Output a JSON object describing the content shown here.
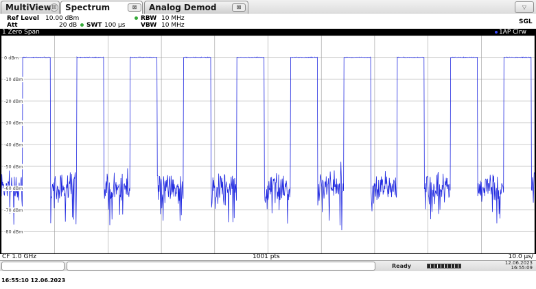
{
  "tabs": [
    {
      "label": "MultiView",
      "icon": "grid-icon"
    },
    {
      "label": "Spectrum",
      "icon": "close-icon",
      "active": true
    },
    {
      "label": "Analog Demod",
      "icon": "close-icon"
    }
  ],
  "dropdown_icon": "chevron-down-icon",
  "params": {
    "ref_level_label": "Ref Level",
    "ref_level_value": "10.00 dBm",
    "att_label": "Att",
    "att_value": "20 dB",
    "swt_label": "SWT",
    "swt_value": "100 µs",
    "rbw_label": "RBW",
    "rbw_value": "10 MHz",
    "vbw_label": "VBW",
    "vbw_value": "10 MHz",
    "mode": "SGL"
  },
  "window": {
    "title": "1 Zero Span",
    "trace_label": "1AP Clrw",
    "trace_color": "#1f28e0",
    "footer_left": "CF 1.0 GHz",
    "footer_center": "1001 pts",
    "footer_right": "10.0 µs/"
  },
  "chart_data": {
    "type": "line",
    "y_tick_labels": [
      "0 dBm",
      "-10 dBm",
      "-20 dBm",
      "-30 dBm",
      "-40 dBm",
      "-50 dBm",
      "-60 dBm",
      "-70 dBm",
      "-80 dBm"
    ],
    "ylim": [
      -90,
      10
    ],
    "xlim": [
      0,
      100
    ],
    "x_unit": "µs",
    "grid": true,
    "bursts": [
      {
        "on_start": 4.0,
        "on_end": 9.2
      },
      {
        "on_start": 14.1,
        "on_end": 19.2
      },
      {
        "on_start": 24.1,
        "on_end": 29.2
      },
      {
        "on_start": 34.1,
        "on_end": 39.3
      },
      {
        "on_start": 44.1,
        "on_end": 49.3
      },
      {
        "on_start": 54.2,
        "on_end": 59.3
      },
      {
        "on_start": 64.2,
        "on_end": 69.3
      },
      {
        "on_start": 74.2,
        "on_end": 79.3
      },
      {
        "on_start": 84.2,
        "on_end": 89.3
      },
      {
        "on_start": 94.2,
        "on_end": 99.4
      }
    ],
    "on_level": 0,
    "off_level": -60
  },
  "status": {
    "ready": "Ready",
    "progress": 1.0,
    "date": "12.06.2023",
    "time": "16:55:09"
  },
  "timestamp": "16:55:10  12.06.2023"
}
